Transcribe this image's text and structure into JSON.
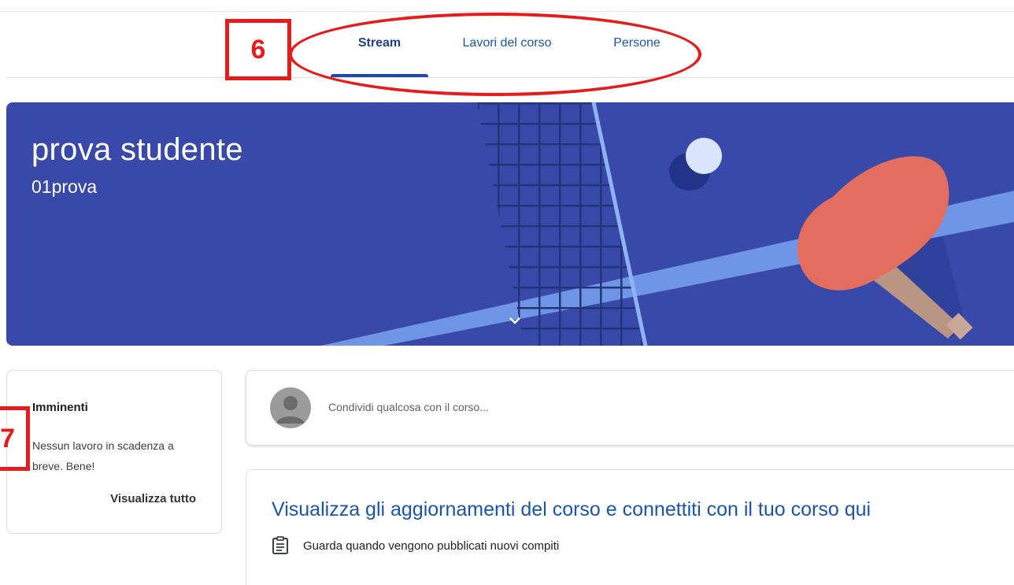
{
  "tabs": [
    {
      "label": "Stream",
      "active": true
    },
    {
      "label": "Lavori del corso",
      "active": false
    },
    {
      "label": "Persone",
      "active": false
    }
  ],
  "annotations": {
    "box6": "6",
    "box7": "7"
  },
  "banner": {
    "title": "prova studente",
    "subtitle": "01prova",
    "theme": "ping-pong",
    "color": "#3849aa"
  },
  "upcoming": {
    "title": "Imminenti",
    "text": "Nessun lavoro in scadenza a breve. Bene!",
    "view_all": "Visualizza tutto"
  },
  "share": {
    "placeholder": "Condividi qualcosa con il corso..."
  },
  "info": {
    "heading": "Visualizza gli aggiornamenti del corso e connettiti con il tuo corso qui",
    "line1": "Guarda quando vengono pubblicati nuovi compiti"
  },
  "icons": [
    "chevron-down-icon",
    "avatar-icon",
    "assignment-icon"
  ],
  "colors": {
    "accent": "#1a56a8",
    "annotation": "#e61b1b"
  }
}
